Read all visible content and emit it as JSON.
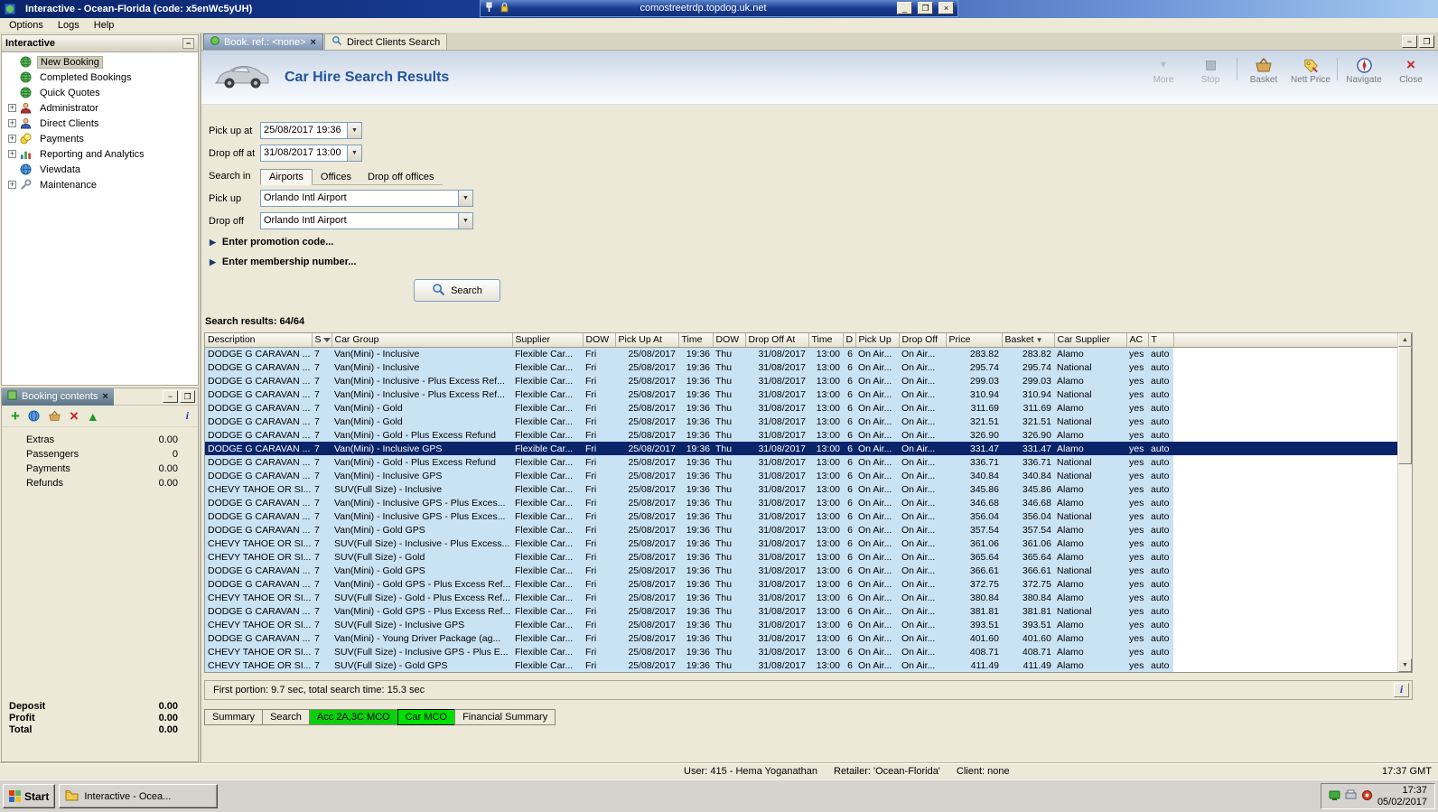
{
  "window": {
    "title": "Interactive - Ocean-Florida (code: x5enWc5yUH)",
    "rdp_title": "comostreetrdp.topdog.uk.net"
  },
  "menubar": {
    "items": [
      "Options",
      "Logs",
      "Help"
    ]
  },
  "sidebar": {
    "title": "Interactive",
    "items": [
      {
        "label": "New Booking",
        "icon": "globe-icon",
        "selected": true,
        "expandable": false
      },
      {
        "label": "Completed Bookings",
        "icon": "globe-icon",
        "expandable": false
      },
      {
        "label": "Quick Quotes",
        "icon": "globe-icon",
        "expandable": false
      },
      {
        "label": "Administrator",
        "icon": "admin-person-icon",
        "expandable": true
      },
      {
        "label": "Direct Clients",
        "icon": "clients-icon",
        "expandable": true
      },
      {
        "label": "Payments",
        "icon": "payments-coins-icon",
        "expandable": true
      },
      {
        "label": "Reporting and Analytics",
        "icon": "chart-icon",
        "expandable": true
      },
      {
        "label": "Viewdata",
        "icon": "globe-blue-icon",
        "expandable": false
      },
      {
        "label": "Maintenance",
        "icon": "wrench-icon",
        "expandable": true
      }
    ]
  },
  "booking_contents": {
    "title": "Booking contents",
    "toolbar_icons": [
      "add-icon",
      "refresh-globe-icon",
      "basket-add-icon",
      "delete-icon",
      "export-icon",
      "info-icon"
    ],
    "rows": [
      {
        "label": "Extras",
        "value": "0.00"
      },
      {
        "label": "Passengers",
        "value": "0"
      },
      {
        "label": "Payments",
        "value": "0.00"
      },
      {
        "label": "Refunds",
        "value": "0.00"
      }
    ],
    "footer": [
      {
        "label": "Deposit",
        "value": "0.00"
      },
      {
        "label": "Profit",
        "value": "0.00"
      },
      {
        "label": "Total",
        "value": "0.00"
      }
    ]
  },
  "doc_tabs": [
    {
      "label": "Book. ref.: <none>",
      "icon": "orb-icon",
      "active": true,
      "closable": true
    },
    {
      "label": "Direct Clients Search",
      "icon": "magnifier-icon",
      "active": false,
      "closable": false
    }
  ],
  "toolbar": {
    "buttons": [
      {
        "label": "More",
        "icon": "more-icon",
        "disabled": true
      },
      {
        "label": "Stop",
        "icon": "stop-icon",
        "disabled": true
      },
      {
        "label": "Basket",
        "icon": "basket-icon",
        "disabled": false
      },
      {
        "label": "Nett Price",
        "icon": "nett-price-icon",
        "disabled": false
      },
      {
        "label": "Navigate",
        "icon": "navigate-icon",
        "disabled": false
      },
      {
        "label": "Close",
        "icon": "close-red-icon",
        "disabled": false
      }
    ]
  },
  "page": {
    "title": "Car Hire Search Results"
  },
  "search_form": {
    "pickup_at_label": "Pick up at",
    "pickup_at_value": "25/08/2017 19:36",
    "dropoff_at_label": "Drop off at",
    "dropoff_at_value": "31/08/2017 13:00",
    "search_in_label": "Search in",
    "search_in_tabs": [
      "Airports",
      "Offices",
      "Drop off offices"
    ],
    "search_in_active": 0,
    "pickup_label": "Pick up",
    "pickup_value": "Orlando Intl Airport",
    "dropoff_label": "Drop off",
    "dropoff_value": "Orlando Intl Airport",
    "promo_label": "Enter promotion code...",
    "membership_label": "Enter membership number...",
    "search_button": "Search"
  },
  "results": {
    "count_label": "Search results: 64/64",
    "status": "First portion: 9.7 sec, total search time: 15.3 sec",
    "columns": [
      "Description",
      "S",
      "Car Group",
      "Supplier",
      "DOW",
      "Pick Up At",
      "Time",
      "DOW",
      "Drop Off At",
      "Time",
      "D",
      "Pick Up",
      "Drop Off",
      "Price",
      "Basket",
      "Car Supplier",
      "AC",
      "T"
    ],
    "filter_column": "S",
    "sort_column": "Basket",
    "shared": {
      "supplier": "Flexible Car...",
      "pickup_dow": "Fri",
      "pickup_date": "25/08/2017",
      "pickup_time": "19:36",
      "dropoff_dow": "Thu",
      "dropoff_date": "31/08/2017",
      "dropoff_time": "13:00",
      "days": "6",
      "pickup_location": "On Air...",
      "dropoff_location": "On Air...",
      "ac": "yes",
      "transmission": "auto"
    },
    "rows": [
      {
        "description": "DODGE G CARAVAN ...",
        "s": "7",
        "car_group": "Van(Mini) - Inclusive",
        "price": "283.82",
        "basket": "283.82",
        "car_supplier": "Alamo"
      },
      {
        "description": "DODGE G CARAVAN ...",
        "s": "7",
        "car_group": "Van(Mini) - Inclusive",
        "price": "295.74",
        "basket": "295.74",
        "car_supplier": "National"
      },
      {
        "description": "DODGE G CARAVAN ...",
        "s": "7",
        "car_group": "Van(Mini) - Inclusive - Plus Excess Ref...",
        "price": "299.03",
        "basket": "299.03",
        "car_supplier": "Alamo"
      },
      {
        "description": "DODGE G CARAVAN ...",
        "s": "7",
        "car_group": "Van(Mini) - Inclusive - Plus Excess Ref...",
        "price": "310.94",
        "basket": "310.94",
        "car_supplier": "National"
      },
      {
        "description": "DODGE G CARAVAN ...",
        "s": "7",
        "car_group": "Van(Mini) - Gold",
        "price": "311.69",
        "basket": "311.69",
        "car_supplier": "Alamo"
      },
      {
        "description": "DODGE G CARAVAN ...",
        "s": "7",
        "car_group": "Van(Mini) - Gold",
        "price": "321.51",
        "basket": "321.51",
        "car_supplier": "National"
      },
      {
        "description": "DODGE G CARAVAN ...",
        "s": "7",
        "car_group": "Van(Mini) - Gold - Plus Excess Refund",
        "price": "326.90",
        "basket": "326.90",
        "car_supplier": "Alamo"
      },
      {
        "description": "DODGE G CARAVAN ...",
        "s": "7",
        "car_group": "Van(Mini) - Inclusive GPS",
        "price": "331.47",
        "basket": "331.47",
        "car_supplier": "Alamo",
        "selected": true
      },
      {
        "description": "DODGE G CARAVAN ...",
        "s": "7",
        "car_group": "Van(Mini) - Gold - Plus Excess Refund",
        "price": "336.71",
        "basket": "336.71",
        "car_supplier": "National"
      },
      {
        "description": "DODGE G CARAVAN ...",
        "s": "7",
        "car_group": "Van(Mini) - Inclusive GPS",
        "price": "340.84",
        "basket": "340.84",
        "car_supplier": "National"
      },
      {
        "description": "CHEVY TAHOE OR SI...",
        "s": "7",
        "car_group": "SUV(Full Size) - Inclusive",
        "price": "345.86",
        "basket": "345.86",
        "car_supplier": "Alamo"
      },
      {
        "description": "DODGE G CARAVAN ...",
        "s": "7",
        "car_group": "Van(Mini) - Inclusive GPS - Plus Exces...",
        "price": "346.68",
        "basket": "346.68",
        "car_supplier": "Alamo"
      },
      {
        "description": "DODGE G CARAVAN ...",
        "s": "7",
        "car_group": "Van(Mini) - Inclusive GPS - Plus Exces...",
        "price": "356.04",
        "basket": "356.04",
        "car_supplier": "National"
      },
      {
        "description": "DODGE G CARAVAN ...",
        "s": "7",
        "car_group": "Van(Mini) - Gold GPS",
        "price": "357.54",
        "basket": "357.54",
        "car_supplier": "Alamo"
      },
      {
        "description": "CHEVY TAHOE OR SI...",
        "s": "7",
        "car_group": "SUV(Full Size) - Inclusive - Plus Excess...",
        "price": "361.06",
        "basket": "361.06",
        "car_supplier": "Alamo"
      },
      {
        "description": "CHEVY TAHOE OR SI...",
        "s": "7",
        "car_group": "SUV(Full Size) - Gold",
        "price": "365.64",
        "basket": "365.64",
        "car_supplier": "Alamo"
      },
      {
        "description": "DODGE G CARAVAN ...",
        "s": "7",
        "car_group": "Van(Mini) - Gold GPS",
        "price": "366.61",
        "basket": "366.61",
        "car_supplier": "National"
      },
      {
        "description": "DODGE G CARAVAN ...",
        "s": "7",
        "car_group": "Van(Mini) - Gold GPS - Plus Excess Ref...",
        "price": "372.75",
        "basket": "372.75",
        "car_supplier": "Alamo"
      },
      {
        "description": "CHEVY TAHOE OR SI...",
        "s": "7",
        "car_group": "SUV(Full Size) - Gold - Plus Excess Ref...",
        "price": "380.84",
        "basket": "380.84",
        "car_supplier": "Alamo"
      },
      {
        "description": "DODGE G CARAVAN ...",
        "s": "7",
        "car_group": "Van(Mini) - Gold GPS - Plus Excess Ref...",
        "price": "381.81",
        "basket": "381.81",
        "car_supplier": "National"
      },
      {
        "description": "CHEVY TAHOE OR SI...",
        "s": "7",
        "car_group": "SUV(Full Size) - Inclusive GPS",
        "price": "393.51",
        "basket": "393.51",
        "car_supplier": "Alamo"
      },
      {
        "description": "DODGE G CARAVAN ...",
        "s": "7",
        "car_group": "Van(Mini) - Young Driver Package (ag...",
        "price": "401.60",
        "basket": "401.60",
        "car_supplier": "Alamo"
      },
      {
        "description": "CHEVY TAHOE OR SI...",
        "s": "7",
        "car_group": "SUV(Full Size) - Inclusive GPS - Plus E...",
        "price": "408.71",
        "basket": "408.71",
        "car_supplier": "Alamo"
      },
      {
        "description": "CHEVY TAHOE OR SI...",
        "s": "7",
        "car_group": "SUV(Full Size) - Gold GPS",
        "price": "411.49",
        "basket": "411.49",
        "car_supplier": "Alamo"
      }
    ]
  },
  "bottom_tabs": [
    {
      "label": "Summary"
    },
    {
      "label": "Search"
    },
    {
      "label": "Acc 2A,3C MCO",
      "green": true
    },
    {
      "label": "Car MCO",
      "green": true,
      "active": true
    },
    {
      "label": "Financial Summary"
    }
  ],
  "statusbar": {
    "user": "User: 415 - Hema Yoganathan",
    "retailer": "Retailer: 'Ocean-Florida'",
    "client": "Client: none",
    "time": "17:37 GMT"
  },
  "taskbar": {
    "start_label": "Start",
    "task_label": "Interactive - Ocea...",
    "clock_time": "17:37",
    "clock_date": "05/02/2017"
  }
}
